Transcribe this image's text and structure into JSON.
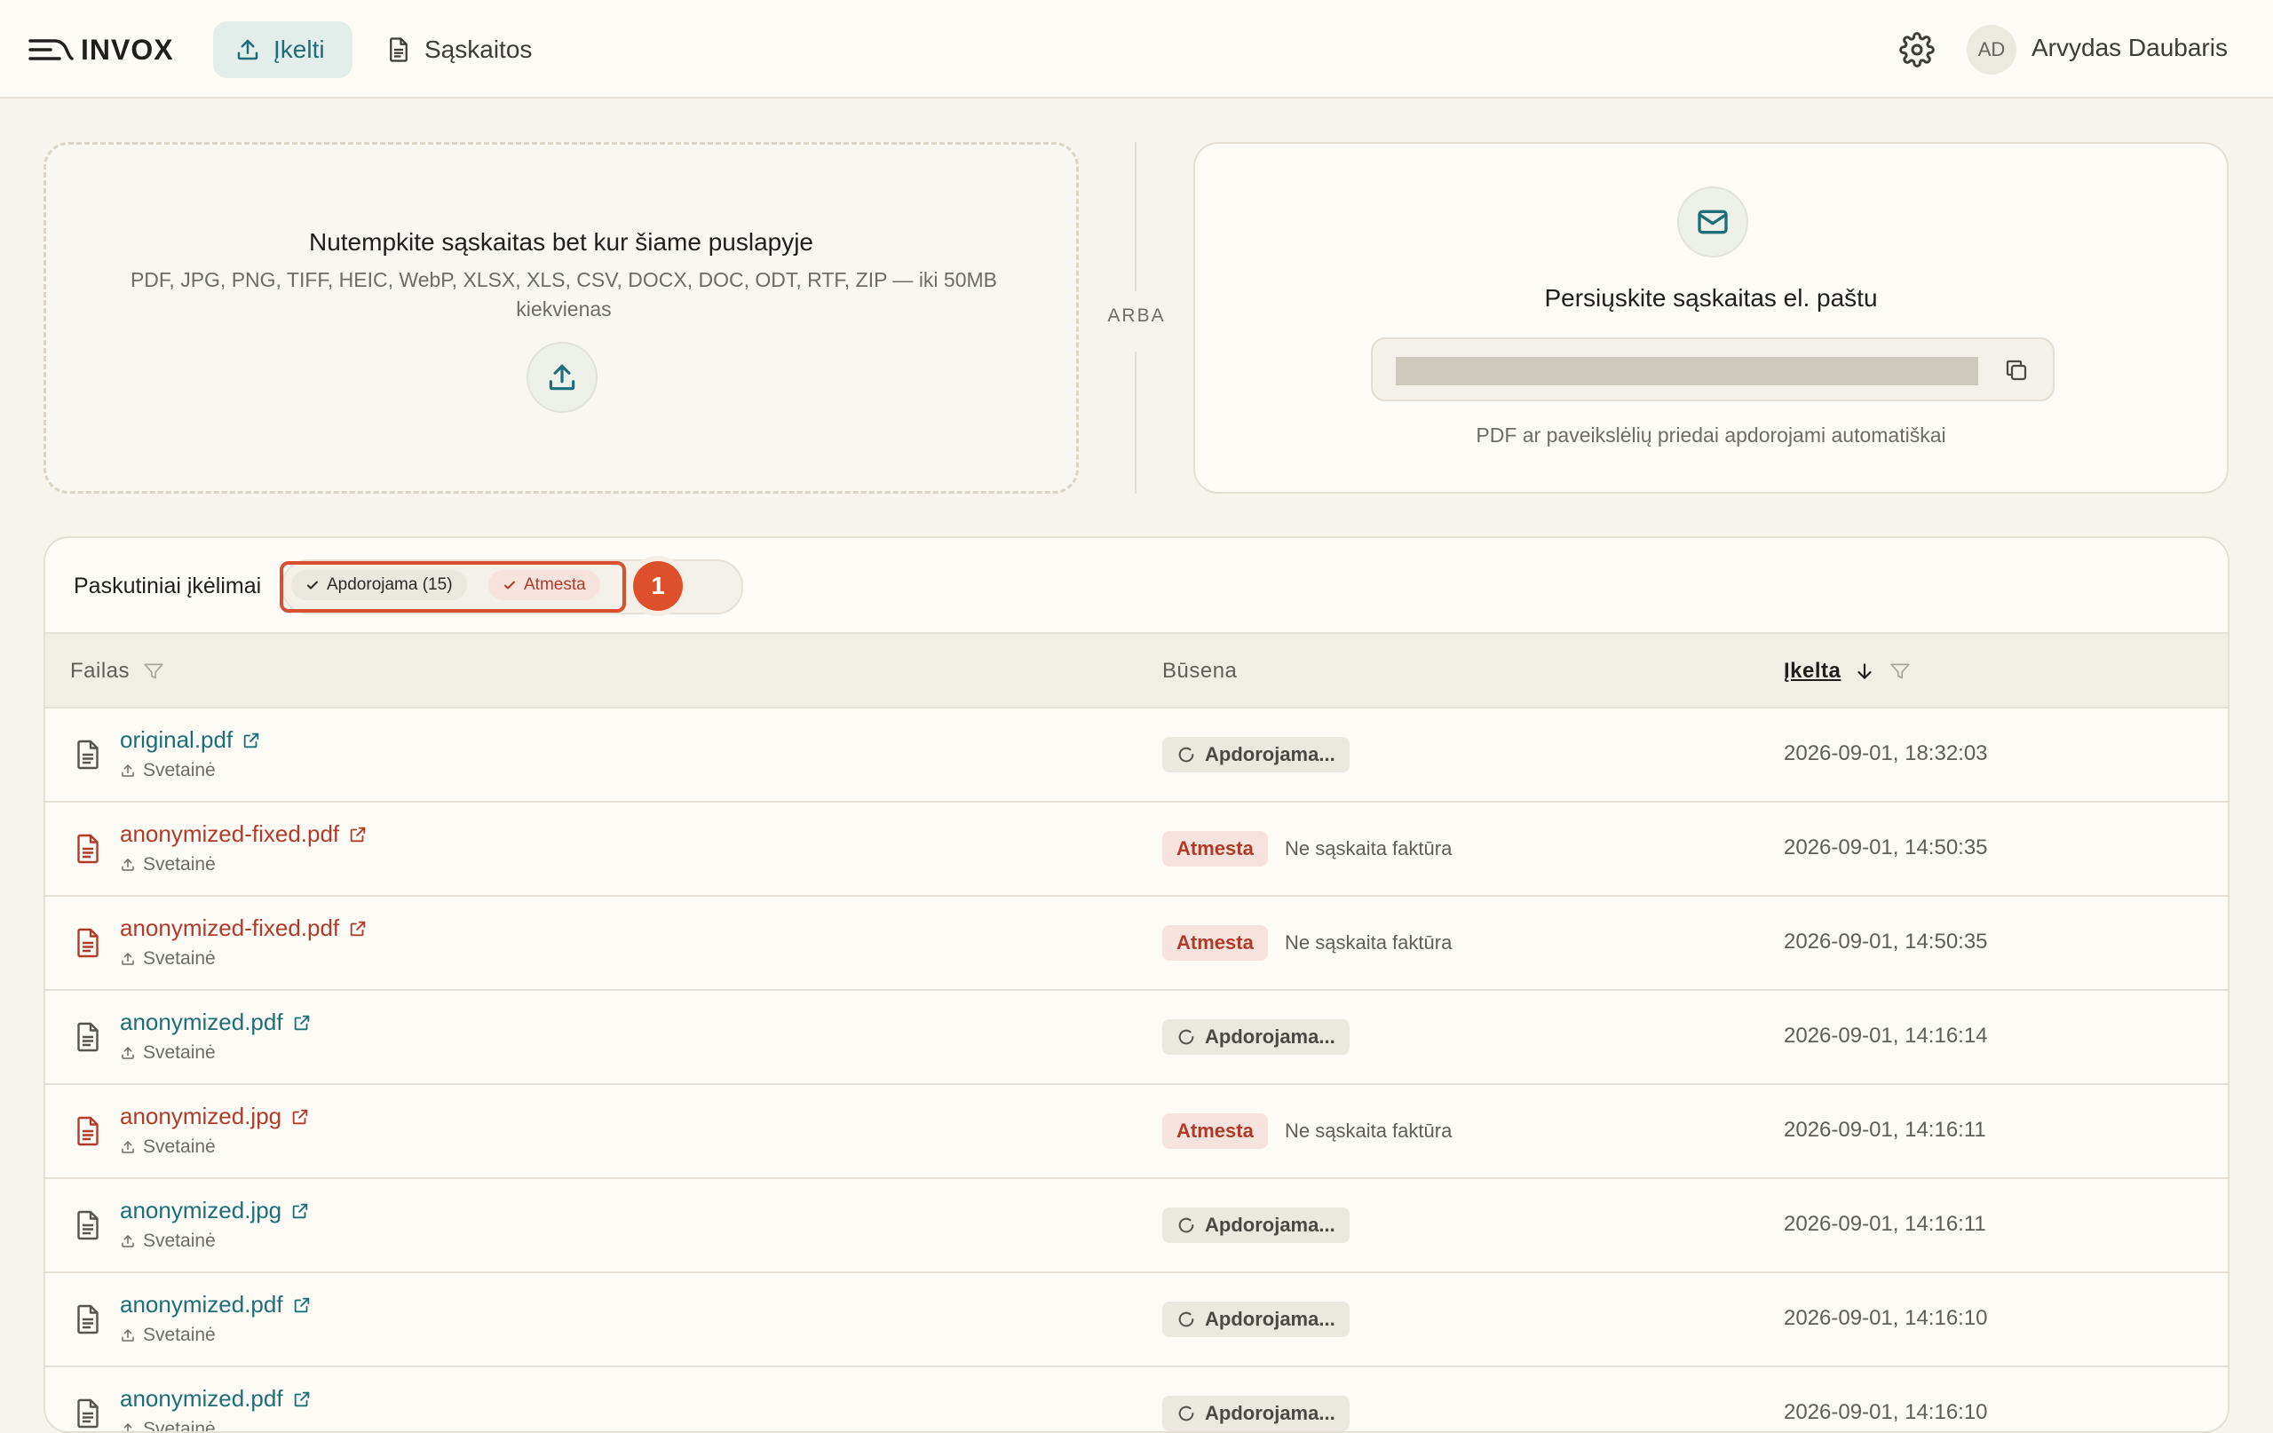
{
  "header": {
    "logo_text": "INVOX",
    "nav": [
      {
        "label": "Įkelti",
        "icon": "upload-icon",
        "active": true
      },
      {
        "label": "Sąskaitos",
        "icon": "document-icon",
        "active": false
      }
    ],
    "settings_icon": "gear-icon",
    "user": {
      "initials": "AD",
      "name": "Arvydas Daubaris"
    }
  },
  "dropzone": {
    "title": "Nutempkite sąskaitas bet kur šiame puslapyje",
    "subtitle": "PDF, JPG, PNG, TIFF, HEIC, WebP, XLSX, XLS, CSV, DOCX, DOC, ODT, RTF, ZIP — iki 50MB kiekvienas",
    "icon": "upload-icon"
  },
  "separator": "ARBA",
  "email_card": {
    "icon": "mail-icon",
    "title": "Persiųskite sąskaitas el. paštu",
    "address_redacted": true,
    "copy_icon": "copy-icon",
    "note": "PDF ar paveikslėlių priedai apdorojami automatiškai"
  },
  "uploads": {
    "title": "Paskutiniai įkėlimai",
    "filters": [
      {
        "label": "Apdorojama (15)",
        "checked": true
      },
      {
        "label": "Atmesta",
        "checked": true
      }
    ],
    "step_badge": "1",
    "columns": {
      "file": "Failas",
      "status": "Būsena",
      "uploaded": "Įkelta"
    },
    "rows": [
      {
        "name": "original.pdf",
        "source": "Svetainė",
        "status": "processing",
        "status_label": "Apdorojama...",
        "reason": "",
        "date": "2026-09-01, 18:32:03"
      },
      {
        "name": "anonymized-fixed.pdf",
        "source": "Svetainė",
        "status": "rejected",
        "status_label": "Atmesta",
        "reason": "Ne sąskaita faktūra",
        "date": "2026-09-01, 14:50:35"
      },
      {
        "name": "anonymized-fixed.pdf",
        "source": "Svetainė",
        "status": "rejected",
        "status_label": "Atmesta",
        "reason": "Ne sąskaita faktūra",
        "date": "2026-09-01, 14:50:35"
      },
      {
        "name": "anonymized.pdf",
        "source": "Svetainė",
        "status": "processing",
        "status_label": "Apdorojama...",
        "reason": "",
        "date": "2026-09-01, 14:16:14"
      },
      {
        "name": "anonymized.jpg",
        "source": "Svetainė",
        "status": "rejected",
        "status_label": "Atmesta",
        "reason": "Ne sąskaita faktūra",
        "date": "2026-09-01, 14:16:11"
      },
      {
        "name": "anonymized.jpg",
        "source": "Svetainė",
        "status": "processing",
        "status_label": "Apdorojama...",
        "reason": "",
        "date": "2026-09-01, 14:16:11"
      },
      {
        "name": "anonymized.pdf",
        "source": "Svetainė",
        "status": "processing",
        "status_label": "Apdorojama...",
        "reason": "",
        "date": "2026-09-01, 14:16:10"
      },
      {
        "name": "anonymized.pdf",
        "source": "Svetainė",
        "status": "processing",
        "status_label": "Apdorojama...",
        "reason": "",
        "date": "2026-09-01, 14:16:10"
      }
    ]
  },
  "colors": {
    "accent": "#1d6e78",
    "rejected": "#b23b28",
    "highlight": "#de4f2b",
    "background": "#f7f4ee"
  }
}
